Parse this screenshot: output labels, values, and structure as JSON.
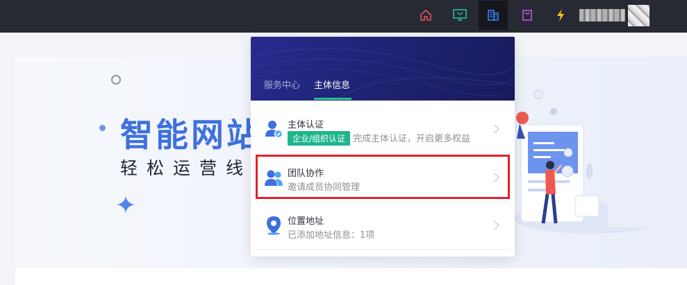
{
  "nav": {
    "icons": [
      {
        "name": "home-icon",
        "color": "#e4585d"
      },
      {
        "name": "monitor-icon",
        "color": "#22c1a2"
      },
      {
        "name": "building-icon",
        "color": "#3d8bff",
        "active": true
      },
      {
        "name": "bag-icon",
        "color": "#c357e2"
      },
      {
        "name": "lightning-icon",
        "color": "#f5c61f"
      }
    ]
  },
  "hero": {
    "title": "智能网站",
    "subtitle": "轻松运营线"
  },
  "popup": {
    "tabs": [
      {
        "label": "服务中心",
        "active": false
      },
      {
        "label": "主体信息",
        "active": true
      }
    ],
    "items": [
      {
        "title": "主体认证",
        "badge": "企业/组织认证",
        "desc": "完成主体认证，开启更多权益",
        "icon": "user-check-icon"
      },
      {
        "title": "团队协作",
        "desc": "邀请成员协同管理",
        "icon": "team-icon"
      },
      {
        "title": "位置地址",
        "desc": "已添加地址信息：1项",
        "icon": "location-pin-icon"
      }
    ]
  },
  "colors": {
    "accent_blue": "#3f70e0",
    "accent_green": "#1fb58c",
    "highlight_red": "#e0212b"
  }
}
